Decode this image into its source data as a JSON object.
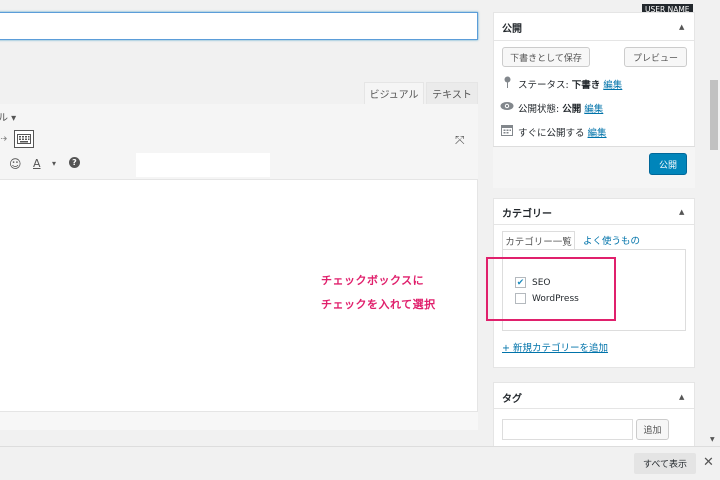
{
  "header": {
    "user_name": "USER NAME"
  },
  "editor": {
    "tabs": [
      {
        "label": "ビジュアル"
      },
      {
        "label": "テキスト"
      }
    ],
    "format_label": "ル ▾",
    "redo_icon": "⇢",
    "expand_icon": "⤧",
    "smiley_icon": "☺",
    "font_color_icon": "A",
    "caret_icon": "▾",
    "help_icon": "?"
  },
  "annotation": {
    "line1": "チェックボックスに",
    "line2": "チェックを入れて選択",
    "color": "#e0206c"
  },
  "publish": {
    "title": "公開",
    "save_draft": "下書きとして保存",
    "preview": "プレビュー",
    "status_label": "ステータス: ",
    "status_value": "下書き",
    "visibility_label": "公開状態: ",
    "visibility_value": "公開",
    "schedule_label": "すぐに公開する",
    "edit_link": "編集",
    "publish_button": "公開",
    "icons": {
      "status": "pin-icon",
      "visibility": "eye-icon",
      "schedule": "calendar-icon"
    }
  },
  "categories": {
    "title": "カテゴリー",
    "tab_all": "カテゴリー一覧",
    "tab_popular": "よく使うもの",
    "items": [
      {
        "label": "SEO",
        "checked": true
      },
      {
        "label": "WordPress",
        "checked": false
      }
    ],
    "add_new": "+ 新規カテゴリーを追加"
  },
  "tags": {
    "title": "タグ",
    "add_button": "追加"
  },
  "footer": {
    "show_all": "すべて表示",
    "close": "✕"
  },
  "colors": {
    "accent": "#0085ba",
    "link": "#0073aa",
    "annotation": "#e0206c"
  }
}
